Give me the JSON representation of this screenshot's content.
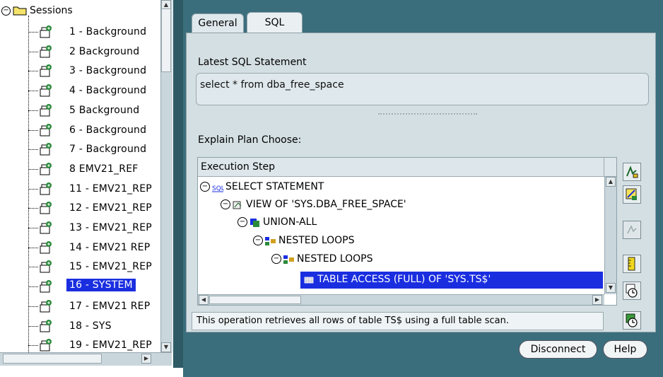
{
  "tree": {
    "root_label": "Sessions",
    "items": [
      {
        "label": "1 - Background"
      },
      {
        "label": "2  Background"
      },
      {
        "label": "3 - Background"
      },
      {
        "label": "4 - Background"
      },
      {
        "label": "5  Background"
      },
      {
        "label": "6 - Background"
      },
      {
        "label": "7 - Background"
      },
      {
        "label": "8  EMV21_REF"
      },
      {
        "label": "11 - EMV21_REP"
      },
      {
        "label": "12 - EMV21_REP"
      },
      {
        "label": "13 - EMV21_REP"
      },
      {
        "label": "14 - EMV21  REP"
      },
      {
        "label": "15 - EMV21_REP"
      },
      {
        "label": "16 - SYSTEM",
        "selected": true
      },
      {
        "label": "17 - EMV21  REP"
      },
      {
        "label": "18 - SYS"
      },
      {
        "label": "19 - EMV21_REP"
      }
    ]
  },
  "tabs": [
    {
      "label": "General"
    },
    {
      "label": "SQL",
      "active": true
    }
  ],
  "sql_panel": {
    "latest_label": "Latest SQL Statement",
    "statement": "select * from dba_free_space",
    "explain_label": "Explain Plan Choose:",
    "column_header": "Execution Step",
    "steps": [
      {
        "label": "SELECT STATEMENT",
        "icon": "sql-icon"
      },
      {
        "label": "VIEW OF 'SYS.DBA_FREE_SPACE'",
        "icon": "view-icon"
      },
      {
        "label": "UNION-ALL",
        "icon": "union-icon"
      },
      {
        "label": "NESTED LOOPS",
        "icon": "nested-loops-icon"
      },
      {
        "label": "NESTED LOOPS",
        "icon": "nested-loops-icon"
      },
      {
        "label": "TABLE ACCESS (FULL) OF 'SYS.TS$'",
        "icon": "table-icon",
        "selected": true
      }
    ],
    "status_text": "This operation retrieves all rows of table TS$ using a full table scan."
  },
  "buttons": {
    "disconnect": "Disconnect",
    "help": "Help"
  },
  "colors": {
    "background_teal": "#3b6e7c",
    "selection_blue": "#1a2ee0",
    "panel_gray": "#d4dfe3"
  }
}
